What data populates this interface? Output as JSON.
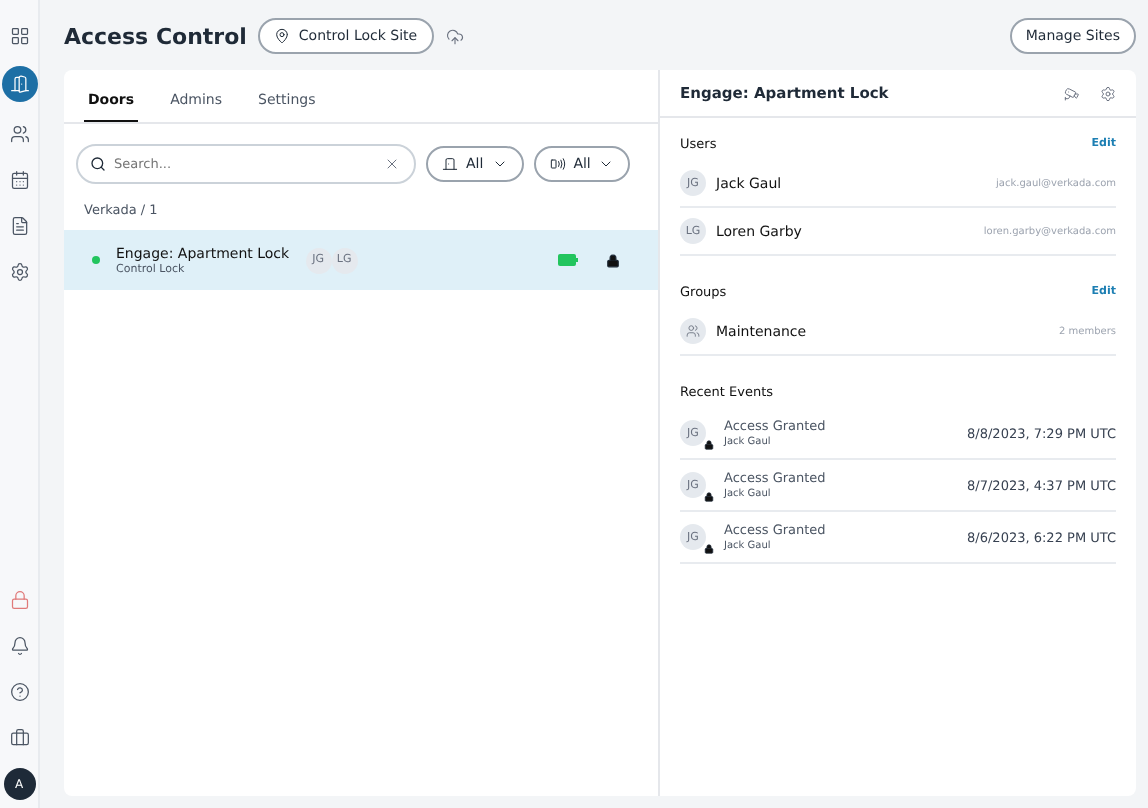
{
  "sidebar": {
    "items": [
      {
        "kind": "apps",
        "selected": false
      },
      {
        "kind": "door",
        "selected": true
      },
      {
        "kind": "people",
        "selected": false
      },
      {
        "kind": "calendar",
        "selected": false
      },
      {
        "kind": "report",
        "selected": false
      },
      {
        "kind": "settings",
        "selected": false
      }
    ],
    "bottom_items": [
      {
        "kind": "lock"
      },
      {
        "kind": "bell"
      },
      {
        "kind": "help"
      },
      {
        "kind": "briefcase"
      }
    ],
    "avatar": "A"
  },
  "header": {
    "title": "Access Control",
    "site": "Control Lock Site",
    "manage_button": "Manage Sites"
  },
  "tabs": [
    {
      "label": "Doors",
      "selected": true
    },
    {
      "label": "Admins",
      "selected": false
    },
    {
      "label": "Settings",
      "selected": false
    }
  ],
  "search": {
    "placeholder": "Search..."
  },
  "filters": [
    {
      "kind": "door",
      "label": "All"
    },
    {
      "kind": "lock",
      "label": "All"
    }
  ],
  "breadcrumb": "Verkada / 1",
  "doors": [
    {
      "name": "Engage: Apartment Lock",
      "type": "Control Lock",
      "online": true,
      "selected": true,
      "users": [
        "JG",
        "LG"
      ],
      "battery_full": true,
      "locked": true
    }
  ],
  "detail": {
    "title": "Engage: Apartment Lock",
    "users": {
      "heading": "Users",
      "edit": "Edit",
      "items": [
        {
          "initials": "JG",
          "name": "Jack Gaul",
          "email": "jack.gaul@verkada.com"
        },
        {
          "initials": "LG",
          "name": "Loren Garby",
          "email": "loren.garby@verkada.com"
        }
      ]
    },
    "groups": {
      "heading": "Groups",
      "edit": "Edit",
      "items": [
        {
          "name": "Maintenance",
          "count": "2 members"
        }
      ]
    },
    "events": {
      "heading": "Recent Events",
      "items": [
        {
          "initials": "JG",
          "title": "Access Granted",
          "user": "Jack Gaul",
          "time": "8/8/2023, 7:29 PM UTC"
        },
        {
          "initials": "JG",
          "title": "Access Granted",
          "user": "Jack Gaul",
          "time": "8/7/2023, 4:37 PM UTC"
        },
        {
          "initials": "JG",
          "title": "Access Granted",
          "user": "Jack Gaul",
          "time": "8/6/2023, 6:22 PM UTC"
        }
      ]
    }
  }
}
